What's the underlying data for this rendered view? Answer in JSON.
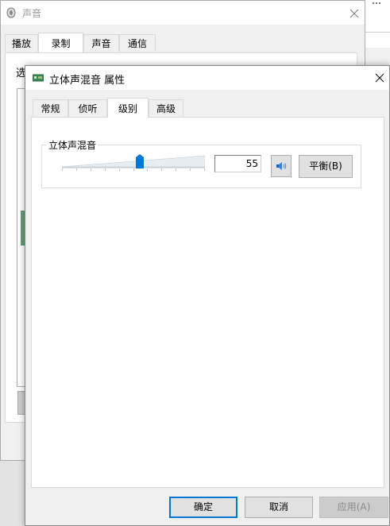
{
  "back_window": {
    "title": "声音",
    "tabs": [
      "播放",
      "录制",
      "声音",
      "通信"
    ],
    "active_tab": 1,
    "partial_text": "选"
  },
  "dialog": {
    "title": "立体声混音 属性",
    "tabs": [
      "常规",
      "侦听",
      "级别",
      "高级"
    ],
    "active_tab": 2,
    "level_group": {
      "label": "立体声混音",
      "value": "55",
      "slider_fraction": 0.55,
      "balance_label": "平衡(B)"
    },
    "buttons": {
      "ok": "确定",
      "cancel": "取消",
      "apply": "应用(A)"
    }
  },
  "colors": {
    "accent": "#0078d7",
    "thumb": "#0078d7"
  },
  "icons": {
    "dialog_icon": "sound-card-icon",
    "mute_icon": "speaker-icon",
    "close_icon": "close-icon"
  }
}
